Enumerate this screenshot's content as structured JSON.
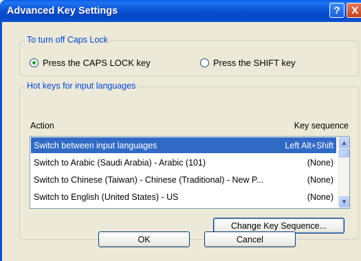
{
  "window": {
    "title": "Advanced Key Settings",
    "help_glyph": "?",
    "close_glyph": "X"
  },
  "caps_lock": {
    "group_label": "To turn off Caps Lock",
    "options": [
      {
        "label": "Press the CAPS LOCK key",
        "checked": true
      },
      {
        "label": "Press the SHIFT key",
        "checked": false
      }
    ]
  },
  "hot_keys": {
    "group_label": "Hot keys for input languages",
    "columns": {
      "action": "Action",
      "key_sequence": "Key sequence"
    },
    "rows": [
      {
        "action": "Switch between input languages",
        "sequence": "Left Alt+Shift",
        "selected": true
      },
      {
        "action": "Switch to Arabic (Saudi Arabia) - Arabic (101)",
        "sequence": "(None)",
        "selected": false
      },
      {
        "action": "Switch to Chinese (Taiwan) - Chinese (Traditional) - New P...",
        "sequence": "(None)",
        "selected": false
      },
      {
        "action": "Switch to English (United States) - US",
        "sequence": "(None)",
        "selected": false
      }
    ],
    "change_button": "Change Key Sequence..."
  },
  "footer": {
    "ok": "OK",
    "cancel": "Cancel"
  },
  "colors": {
    "titlebar": "#0A55D6",
    "group_label": "#0046D5",
    "selection": "#316AC5"
  }
}
